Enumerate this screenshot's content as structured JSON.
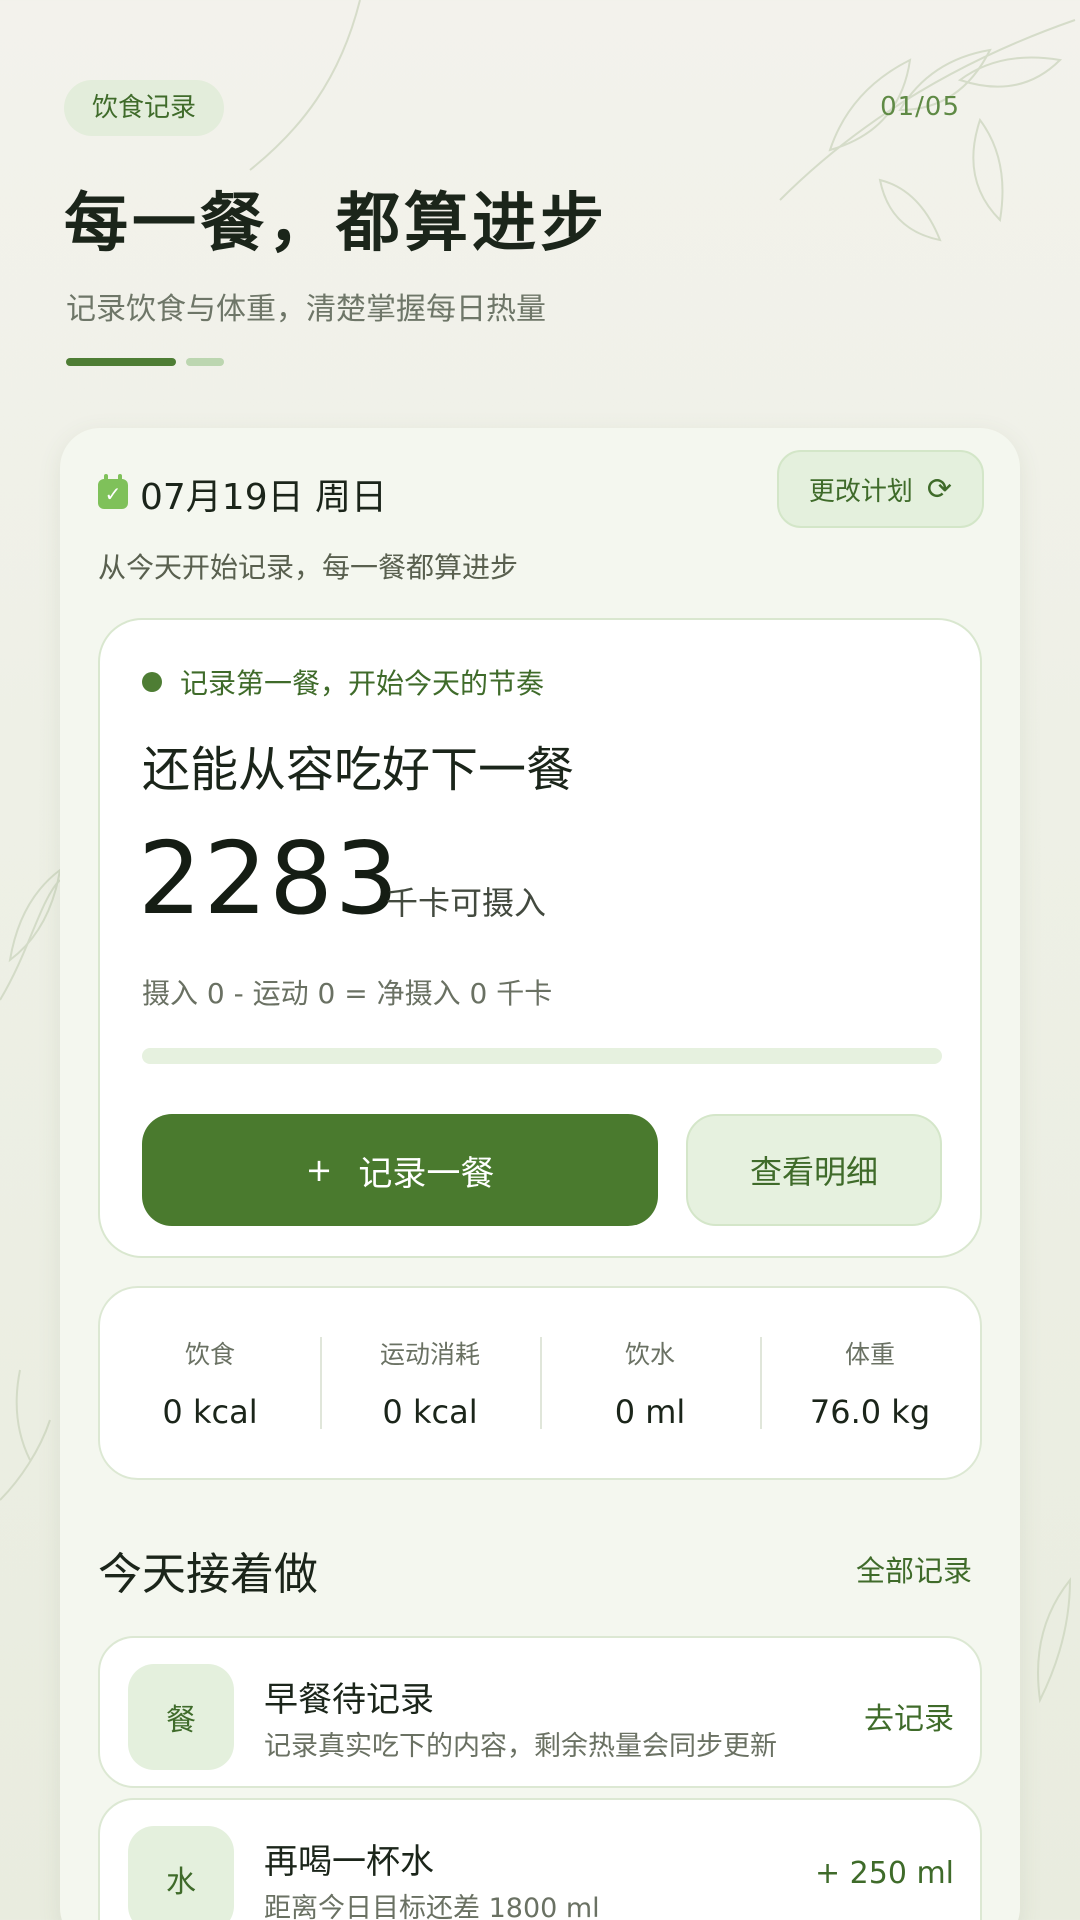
{
  "header": {
    "tag": "饮食记录",
    "page_counter": "01/05",
    "title": "每一餐，都算进步",
    "subtitle": "记录饮食与体重，清楚掌握每日热量"
  },
  "date_bar": {
    "date": "07月19日 周日",
    "change_plan_label": "更改计划",
    "subtitle": "从今天开始记录，每一餐都算进步"
  },
  "calorie_card": {
    "status": "记录第一餐，开始今天的节奏",
    "heading": "还能从容吃好下一餐",
    "remaining": "2283",
    "remaining_unit": "千卡可摄入",
    "formula": "摄入 0 - 运动 0 = 净摄入 0 千卡",
    "progress_fraction": 0,
    "primary_button_icon": "+",
    "primary_button_label": "记录一餐",
    "secondary_button_label": "查看明细"
  },
  "stats": [
    {
      "label": "饮食",
      "value": "0 kcal"
    },
    {
      "label": "运动消耗",
      "value": "0 kcal"
    },
    {
      "label": "饮水",
      "value": "0 ml"
    },
    {
      "label": "体重",
      "value": "76.0 kg"
    }
  ],
  "today": {
    "title": "今天接着做",
    "all_link": "全部记录",
    "tasks": [
      {
        "badge": "餐",
        "title": "早餐待记录",
        "desc": "记录真实吃下的内容，剩余热量会同步更新",
        "action": "去记录"
      },
      {
        "badge": "水",
        "title": "再喝一杯水",
        "desc": "距离今日目标还差 1800 ml",
        "action": "+ 250 ml"
      }
    ]
  },
  "icons": {
    "calendar": "calendar-check-icon",
    "refresh": "refresh-icon",
    "plus": "plus-icon"
  },
  "colors": {
    "accent": "#4a7a2e",
    "accent_light": "#e4f0dd",
    "background": "#eef0e6"
  }
}
